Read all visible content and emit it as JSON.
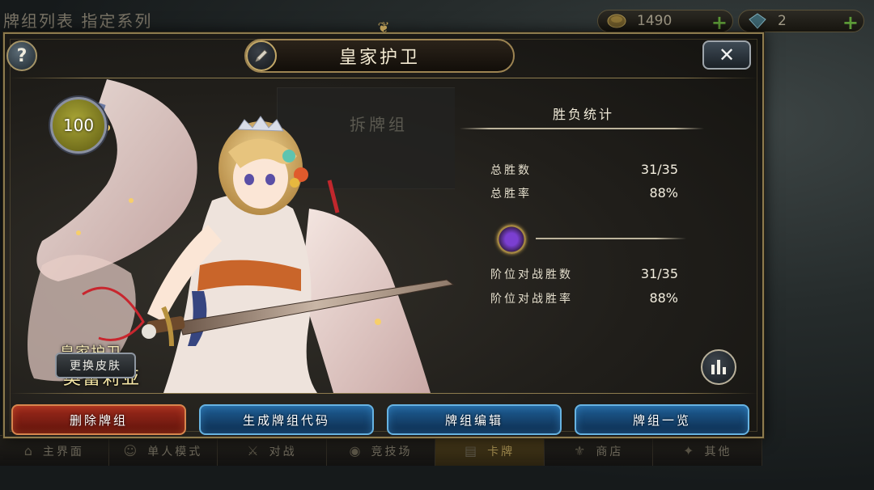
{
  "background": {
    "title": "牌组列表 指定系列",
    "resources": [
      {
        "icon": "gold-coin-icon",
        "value": "1490"
      },
      {
        "icon": "gem-icon",
        "value": "2"
      }
    ],
    "nav": [
      {
        "label": "主界面",
        "icon": "home-icon"
      },
      {
        "label": "单人模式",
        "icon": "person-icon"
      },
      {
        "label": "对战",
        "icon": "crossed-swords-icon"
      },
      {
        "label": "竞技场",
        "icon": "arena-icon"
      },
      {
        "label": "卡牌",
        "icon": "cards-icon"
      },
      {
        "label": "商店",
        "icon": "shop-icon"
      },
      {
        "label": "其他",
        "icon": "more-icon"
      }
    ]
  },
  "dialog": {
    "title": "皇家护卫",
    "ghost_label": "拆牌组",
    "level": "100",
    "character": {
      "class": "皇家护卫",
      "name": "奥蕾莉亚"
    },
    "skin_button": "更换皮肤",
    "stats": {
      "title": "胜负统计",
      "total_wins_label": "总胜数",
      "total_wins": "31/35",
      "win_rate_label": "总胜率",
      "win_rate": "88%",
      "ranked_wins_label": "阶位对战胜数",
      "ranked_wins": "31/35",
      "ranked_rate_label": "阶位对战胜率",
      "ranked_rate": "88%"
    },
    "actions": {
      "delete": "删除牌组",
      "generate_code": "生成牌组代码",
      "edit": "牌组编辑",
      "overview": "牌组一览"
    }
  },
  "colors": {
    "gold_border": "#8d7b4e",
    "danger": "#9e2a1c",
    "primary": "#1f5f96"
  }
}
